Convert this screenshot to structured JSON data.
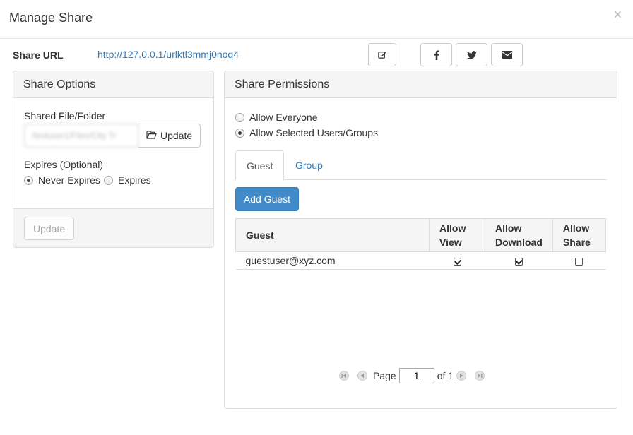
{
  "modal": {
    "title": "Manage Share",
    "close": "×"
  },
  "share_url": {
    "label": "Share URL",
    "value": "http://127.0.0.1/urlktl3mmj0noq4"
  },
  "share_options": {
    "title": "Share Options",
    "file_label": "Shared File/Folder",
    "file_value": "/testuser1/Files/City Tr",
    "update_label": "Update",
    "expires_label": "Expires (Optional)",
    "never_expires": "Never Expires",
    "expires": "Expires",
    "selected_expiry": "Never Expires",
    "footer_update": "Update"
  },
  "permissions": {
    "title": "Share Permissions",
    "allow_everyone": "Allow Everyone",
    "allow_selected": "Allow Selected Users/Groups",
    "selected_mode": "Allow Selected Users/Groups",
    "tabs": [
      {
        "label": "Guest",
        "active": true
      },
      {
        "label": "Group",
        "active": false
      }
    ],
    "add_guest": "Add Guest",
    "columns": {
      "guest": "Guest",
      "view1": "Allow",
      "view2": "View",
      "dl1": "Allow",
      "dl2": "Download",
      "share1": "Allow",
      "share2": "Share"
    },
    "rows": [
      {
        "guest": "guestuser@xyz.com",
        "view": true,
        "download": true,
        "share": false
      }
    ]
  },
  "pagination": {
    "page_label": "Page",
    "page_value": "1",
    "of_label": "of 1"
  },
  "colors": {
    "link": "#337ab7",
    "primary": "#428bca",
    "panel_heading": "#f5f5f5",
    "border": "#ddd"
  },
  "icons": [
    "edit-icon",
    "facebook-icon",
    "twitter-icon",
    "envelope-icon",
    "folder-open-icon",
    "first-page-icon",
    "prev-page-icon",
    "next-page-icon",
    "last-page-icon"
  ]
}
